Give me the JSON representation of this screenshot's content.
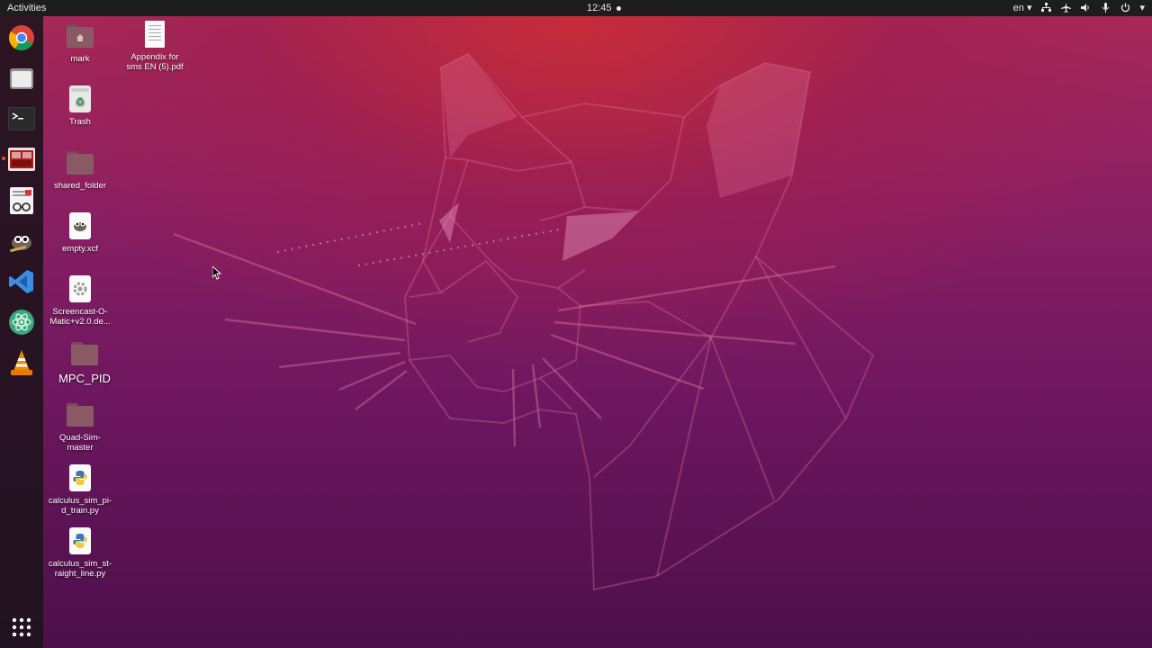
{
  "topbar": {
    "activities": "Activities",
    "clock": "12:45",
    "language": "en",
    "icons": [
      "network-icon",
      "airplane-icon",
      "volume-icon",
      "microphone-icon",
      "power-icon"
    ]
  },
  "dock": {
    "items": [
      {
        "name": "chrome",
        "label": "Google Chrome"
      },
      {
        "name": "files",
        "label": "Files"
      },
      {
        "name": "terminal",
        "label": "Terminal"
      },
      {
        "name": "screencast",
        "label": "Screencast",
        "running": true
      },
      {
        "name": "document-viewer",
        "label": "Document Viewer"
      },
      {
        "name": "gimp",
        "label": "GIMP"
      },
      {
        "name": "vscode",
        "label": "VS Code"
      },
      {
        "name": "atom",
        "label": "Atom"
      },
      {
        "name": "vlc",
        "label": "VLC"
      }
    ],
    "apps_grid": "Show Applications"
  },
  "desktop": {
    "icons": [
      {
        "label": "mark",
        "type": "home-folder"
      },
      {
        "label": "Appendix for\nsms EN (5).pdf",
        "type": "pdf"
      },
      {
        "label": "Trash",
        "type": "trash"
      },
      {
        "label": "shared_folder",
        "type": "folder"
      },
      {
        "label": "empty.xcf",
        "type": "xcf"
      },
      {
        "label": "Screencast-O-\nMatic+v2.0.de...",
        "type": "deb"
      },
      {
        "label": "MPC_PID",
        "type": "folder"
      },
      {
        "label": "Quad-Sim-\nmaster",
        "type": "folder"
      },
      {
        "label": "calculus_sim_pi-\nd_train.py",
        "type": "python"
      },
      {
        "label": "calculus_sim_st-\nraight_line.py",
        "type": "python"
      }
    ]
  },
  "colors": {
    "accent": "#e95420",
    "topbar": "#1d1d1d"
  }
}
